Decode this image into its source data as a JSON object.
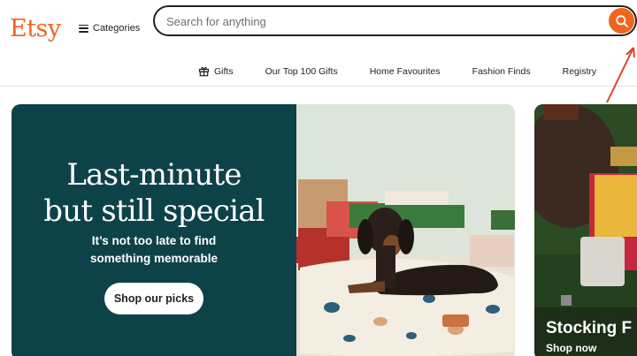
{
  "brand": {
    "logo_text": "Etsy",
    "accent_color": "#f1641e",
    "hero_bg_color": "#0e4249"
  },
  "header": {
    "categories_label": "Categories",
    "categories_icon": "hamburger-menu-icon",
    "search": {
      "placeholder": "Search for anything",
      "value": "",
      "icon": "search-icon"
    }
  },
  "nav": {
    "items": [
      {
        "label": "Gifts",
        "icon": "gift-icon"
      },
      {
        "label": "Our Top 100 Gifts"
      },
      {
        "label": "Home Favourites"
      },
      {
        "label": "Fashion Finds"
      },
      {
        "label": "Registry"
      }
    ]
  },
  "hero": {
    "title_line1": "Last-minute",
    "title_line2": "but still special",
    "subtitle_line1": "It’s not too late to find",
    "subtitle_line2": "something memorable",
    "cta_label": "Shop our picks",
    "image": "dachshund-on-dog-bed-with-gifts"
  },
  "side_card": {
    "title": "Stocking F",
    "link": "Shop now",
    "image": "stocking-fillers-product-photo"
  },
  "annotation": {
    "arrow_color": "#d8442a"
  }
}
